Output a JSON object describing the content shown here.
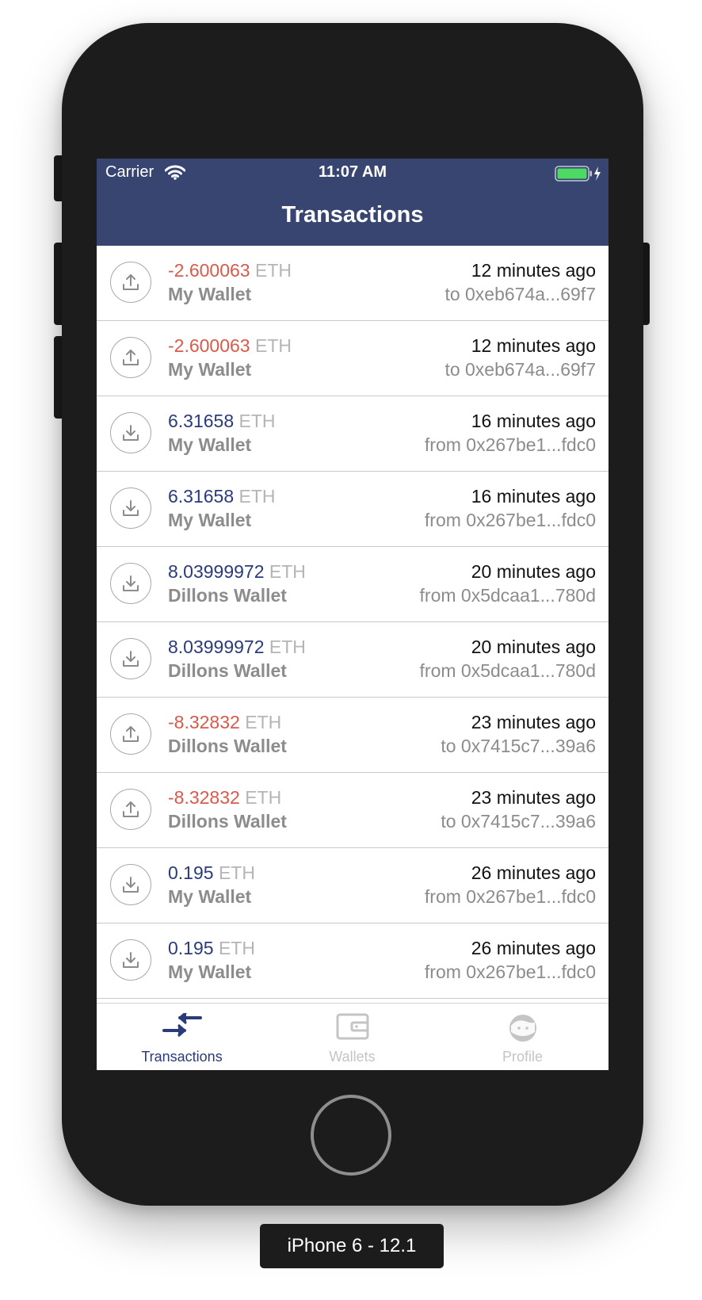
{
  "status_bar": {
    "carrier": "Carrier",
    "time": "11:07 AM"
  },
  "nav": {
    "title": "Transactions"
  },
  "transactions": [
    {
      "direction": "out",
      "amount": "-2.600063",
      "unit": "ETH",
      "wallet": "My Wallet",
      "time": "12 minutes ago",
      "address": "to 0xeb674a...69f7"
    },
    {
      "direction": "out",
      "amount": "-2.600063",
      "unit": "ETH",
      "wallet": "My Wallet",
      "time": "12 minutes ago",
      "address": "to 0xeb674a...69f7"
    },
    {
      "direction": "in",
      "amount": "6.31658",
      "unit": "ETH",
      "wallet": "My Wallet",
      "time": "16 minutes ago",
      "address": "from 0x267be1...fdc0"
    },
    {
      "direction": "in",
      "amount": "6.31658",
      "unit": "ETH",
      "wallet": "My Wallet",
      "time": "16 minutes ago",
      "address": "from 0x267be1...fdc0"
    },
    {
      "direction": "in",
      "amount": "8.03999972",
      "unit": "ETH",
      "wallet": "Dillons Wallet",
      "time": "20 minutes ago",
      "address": "from 0x5dcaa1...780d"
    },
    {
      "direction": "in",
      "amount": "8.03999972",
      "unit": "ETH",
      "wallet": "Dillons Wallet",
      "time": "20 minutes ago",
      "address": "from 0x5dcaa1...780d"
    },
    {
      "direction": "out",
      "amount": "-8.32832",
      "unit": "ETH",
      "wallet": "Dillons Wallet",
      "time": "23 minutes ago",
      "address": "to 0x7415c7...39a6"
    },
    {
      "direction": "out",
      "amount": "-8.32832",
      "unit": "ETH",
      "wallet": "Dillons Wallet",
      "time": "23 minutes ago",
      "address": "to 0x7415c7...39a6"
    },
    {
      "direction": "in",
      "amount": "0.195",
      "unit": "ETH",
      "wallet": "My Wallet",
      "time": "26 minutes ago",
      "address": "from 0x267be1...fdc0"
    },
    {
      "direction": "in",
      "amount": "0.195",
      "unit": "ETH",
      "wallet": "My Wallet",
      "time": "26 minutes ago",
      "address": "from 0x267be1...fdc0"
    }
  ],
  "tabbar": {
    "tabs": [
      {
        "label": "Transactions",
        "icon": "transfer-arrows-icon",
        "active": true
      },
      {
        "label": "Wallets",
        "icon": "wallet-icon",
        "active": false
      },
      {
        "label": "Profile",
        "icon": "profile-face-icon",
        "active": false
      }
    ]
  },
  "device_label": "iPhone 6 - 12.1",
  "colors": {
    "navbar": "#384570",
    "outgoing_amount": "#d9594a",
    "incoming_amount": "#2b3a7a",
    "active_tab": "#2b3a7a",
    "inactive_tab": "#c4c4c4",
    "battery": "#4cd964"
  }
}
